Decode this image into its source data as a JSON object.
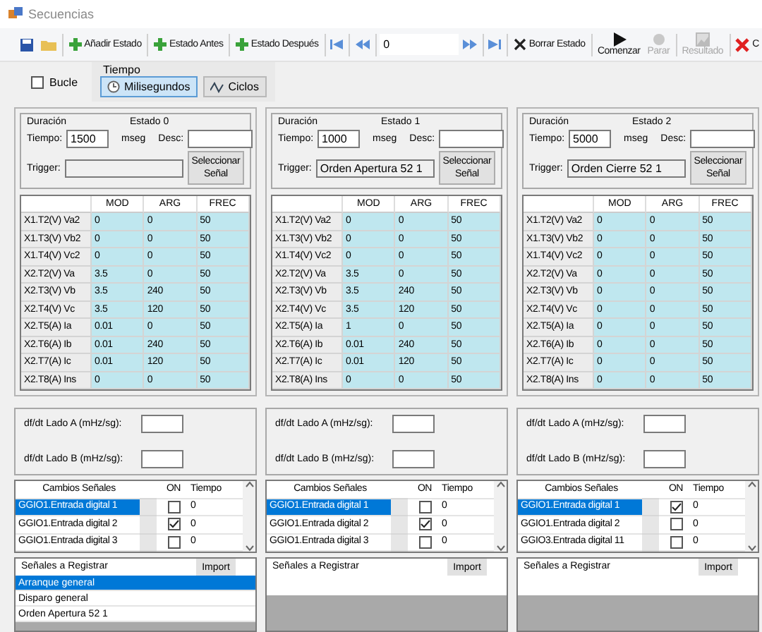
{
  "window": {
    "title": "Secuencias"
  },
  "toolbar": [
    {
      "kind": "icon"
    },
    {
      "kind": "icon"
    },
    {
      "kind": "inline",
      "label": "Añadir Estado"
    },
    {
      "kind": "inline",
      "label": "Estado Antes"
    },
    {
      "kind": "inline",
      "label": "Estado Después"
    },
    {
      "kind": "icon"
    },
    {
      "kind": "icon"
    },
    {
      "kind": "field",
      "value": "0"
    },
    {
      "kind": "icon"
    },
    {
      "kind": "icon"
    },
    {
      "kind": "inline",
      "label": "Borrar Estado"
    },
    {
      "kind": "stacked",
      "label": "Comenzar",
      "disabled": false
    },
    {
      "kind": "stacked",
      "label": "Parar",
      "disabled": true
    },
    {
      "kind": "stacked",
      "label": "Resultado",
      "disabled": true
    },
    {
      "kind": "inline",
      "label": "C"
    }
  ],
  "options": {
    "loop": {
      "label": "Bucle",
      "checked": false
    },
    "time_group": {
      "title": "Tiempo",
      "options": [
        {
          "label": "Milisegundos",
          "selected": true
        },
        {
          "label": "Ciclos",
          "selected": false
        }
      ]
    }
  },
  "states": [
    {
      "duration_label": "Duración",
      "title": "Estado 0",
      "time_label": "Tiempo:",
      "time": "1500",
      "unit": "mseg",
      "desc_label": "Desc:",
      "trigger_label": "Trigger:",
      "select_button": "Seleccionar Señal",
      "columns": [
        "MOD",
        "ARG",
        "FREC"
      ],
      "rows": [
        {
          "name": "X1.T2(V) Va2",
          "mod": "0",
          "arg": "0",
          "frec": "50"
        },
        {
          "name": "X1.T3(V) Vb2",
          "mod": "0",
          "arg": "0",
          "frec": "50"
        },
        {
          "name": "X1.T4(V) Vc2",
          "mod": "0",
          "arg": "0",
          "frec": "50"
        },
        {
          "name": "X2.T2(V) Va",
          "mod": "3.5",
          "arg": "0",
          "frec": "50"
        },
        {
          "name": "X2.T3(V) Vb",
          "mod": "3.5",
          "arg": "240",
          "frec": "50"
        },
        {
          "name": "X2.T4(V) Vc",
          "mod": "3.5",
          "arg": "120",
          "frec": "50"
        },
        {
          "name": "X2.T5(A) Ia",
          "mod": "0.01",
          "arg": "0",
          "frec": "50"
        },
        {
          "name": "X2.T6(A) Ib",
          "mod": "0.01",
          "arg": "240",
          "frec": "50"
        },
        {
          "name": "X2.T7(A) Ic",
          "mod": "0.01",
          "arg": "120",
          "frec": "50"
        },
        {
          "name": "X2.T8(A) Ins",
          "mod": "0",
          "arg": "0",
          "frec": "50"
        }
      ],
      "dfdt_a_label": "df/dt Lado A (mHz/sg):",
      "dfdt_b_label": "df/dt Lado B (mHz/sg):",
      "signals": {
        "columns": [
          "Cambios Señales",
          "ON",
          "Tiempo"
        ],
        "rows": [
          {
            "name": "GGIO1.Entrada digital 1",
            "on": false,
            "time": "0",
            "selected": true
          },
          {
            "name": "GGIO1.Entrada digital 2",
            "on": true,
            "time": "0",
            "selected": false
          },
          {
            "name": "GGIO1.Entrada digital 3",
            "on": false,
            "time": "0",
            "selected": false
          }
        ]
      },
      "register": {
        "title": "Señales a Registrar",
        "button": "Import",
        "items": [
          {
            "label": "Arranque general",
            "selected": true
          },
          {
            "label": "Disparo general",
            "selected": false
          },
          {
            "label": "Orden Apertura 52 1",
            "selected": false
          }
        ]
      }
    },
    {
      "duration_label": "Duración",
      "title": "Estado 1",
      "time_label": "Tiempo:",
      "time": "1000",
      "unit": "mseg",
      "desc_label": "Desc:",
      "trigger_label": "Trigger:",
      "trigger": "Orden Apertura 52 1",
      "select_button": "Seleccionar Señal",
      "columns": [
        "MOD",
        "ARG",
        "FREC"
      ],
      "rows": [
        {
          "name": "X1.T2(V) Va2",
          "mod": "0",
          "arg": "0",
          "frec": "50"
        },
        {
          "name": "X1.T3(V) Vb2",
          "mod": "0",
          "arg": "0",
          "frec": "50"
        },
        {
          "name": "X1.T4(V) Vc2",
          "mod": "0",
          "arg": "0",
          "frec": "50"
        },
        {
          "name": "X2.T2(V) Va",
          "mod": "3.5",
          "arg": "0",
          "frec": "50"
        },
        {
          "name": "X2.T3(V) Vb",
          "mod": "3.5",
          "arg": "240",
          "frec": "50"
        },
        {
          "name": "X2.T4(V) Vc",
          "mod": "3.5",
          "arg": "120",
          "frec": "50"
        },
        {
          "name": "X2.T5(A) Ia",
          "mod": "1",
          "arg": "0",
          "frec": "50"
        },
        {
          "name": "X2.T6(A) Ib",
          "mod": "0.01",
          "arg": "240",
          "frec": "50"
        },
        {
          "name": "X2.T7(A) Ic",
          "mod": "0.01",
          "arg": "120",
          "frec": "50"
        },
        {
          "name": "X2.T8(A) Ins",
          "mod": "0",
          "arg": "0",
          "frec": "50"
        }
      ],
      "dfdt_a_label": "df/dt Lado A (mHz/sg):",
      "dfdt_b_label": "df/dt Lado B (mHz/sg):",
      "signals": {
        "columns": [
          "Cambios Señales",
          "ON",
          "Tiempo"
        ],
        "rows": [
          {
            "name": "GGIO1.Entrada digital 1",
            "on": false,
            "time": "0",
            "selected": true
          },
          {
            "name": "GGIO1.Entrada digital 2",
            "on": true,
            "time": "0",
            "selected": false
          },
          {
            "name": "GGIO1.Entrada digital 3",
            "on": false,
            "time": "0",
            "selected": false
          }
        ]
      },
      "register": {
        "title": "Señales a Registrar",
        "button": "Import"
      }
    },
    {
      "duration_label": "Duración",
      "title": "Estado 2",
      "time_label": "Tiempo:",
      "time": "5000",
      "unit": "mseg",
      "desc_label": "Desc:",
      "trigger_label": "Trigger:",
      "trigger": "Orden Cierre 52 1",
      "select_button": "Seleccionar Señal",
      "columns": [
        "MOD",
        "ARG",
        "FREC"
      ],
      "rows": [
        {
          "name": "X1.T2(V) Va2",
          "mod": "0",
          "arg": "0",
          "frec": "50"
        },
        {
          "name": "X1.T3(V) Vb2",
          "mod": "0",
          "arg": "0",
          "frec": "50"
        },
        {
          "name": "X1.T4(V) Vc2",
          "mod": "0",
          "arg": "0",
          "frec": "50"
        },
        {
          "name": "X2.T2(V) Va",
          "mod": "0",
          "arg": "0",
          "frec": "50"
        },
        {
          "name": "X2.T3(V) Vb",
          "mod": "0",
          "arg": "0",
          "frec": "50"
        },
        {
          "name": "X2.T4(V) Vc",
          "mod": "0",
          "arg": "0",
          "frec": "50"
        },
        {
          "name": "X2.T5(A) Ia",
          "mod": "0",
          "arg": "0",
          "frec": "50"
        },
        {
          "name": "X2.T6(A) Ib",
          "mod": "0",
          "arg": "0",
          "frec": "50"
        },
        {
          "name": "X2.T7(A) Ic",
          "mod": "0",
          "arg": "0",
          "frec": "50"
        },
        {
          "name": "X2.T8(A) Ins",
          "mod": "0",
          "arg": "0",
          "frec": "50"
        }
      ],
      "dfdt_a_label": "df/dt Lado A (mHz/sg):",
      "dfdt_b_label": "df/dt Lado B (mHz/sg):",
      "signals": {
        "columns": [
          "Cambios Señales",
          "ON",
          "Tiempo"
        ],
        "rows": [
          {
            "name": "GGIO1.Entrada digital 1",
            "on": true,
            "time": "0",
            "selected": true
          },
          {
            "name": "GGIO1.Entrada digital 2",
            "on": false,
            "time": "0",
            "selected": false
          },
          {
            "name": "GGIO3.Entrada digital 11",
            "on": false,
            "time": "0",
            "selected": false
          }
        ]
      },
      "register": {
        "title": "Señales a Registrar",
        "button": "Import"
      }
    }
  ]
}
